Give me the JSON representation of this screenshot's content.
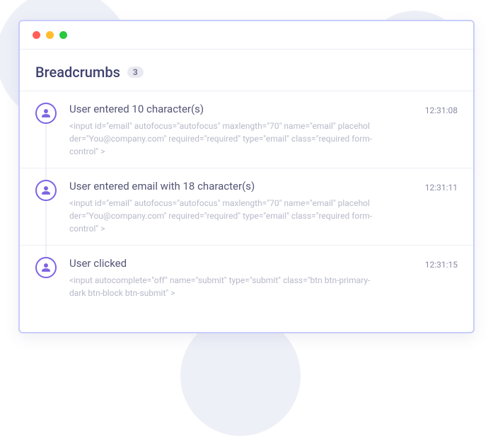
{
  "header": {
    "title": "Breadcrumbs",
    "count": "3"
  },
  "events": [
    {
      "title": "User entered 10 character(s)",
      "detail": "<input id=\"email\" autofocus=\"autofocus\" maxlength=\"70\" name=\"email\" placeholder=\"You@company.com\" required=\"required\" type=\"email\" class=\"required form-control\" >",
      "time": "12:31:08"
    },
    {
      "title": "User entered email with 18 character(s)",
      "detail": "<input id=\"email\" autofocus=\"autofocus\" maxlength=\"70\" name=\"email\" placeholder=\"You@company.com\" required=\"required\" type=\"email\" class=\"required form-control\" >",
      "time": "12:31:11"
    },
    {
      "title": "User clicked",
      "detail": "<input autocomplete=\"off\" name=\"submit\" type=\"submit\" class=\"btn btn-primary-dark btn-block btn-submit\" >",
      "time": "12:31:15"
    }
  ]
}
